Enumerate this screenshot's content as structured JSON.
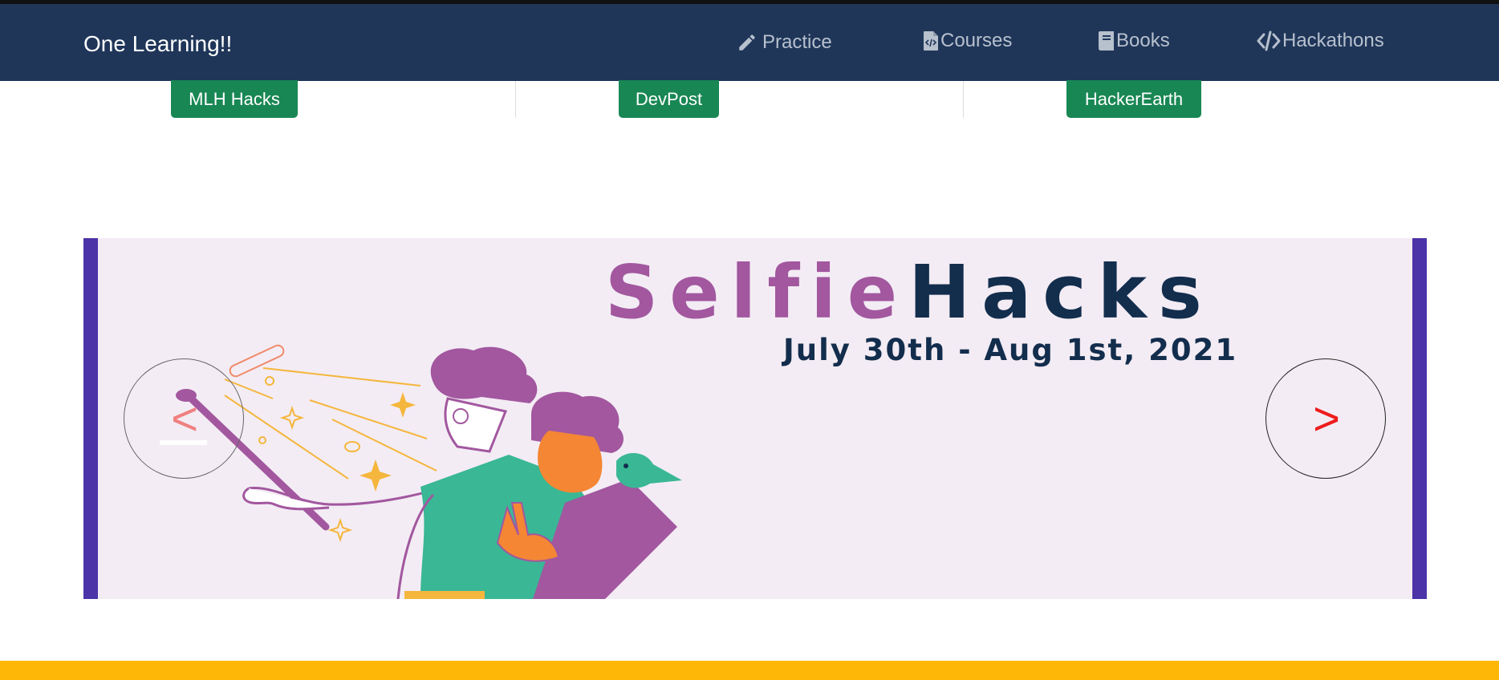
{
  "navbar": {
    "brand": "One Learning!!",
    "items": [
      {
        "label": "Practice",
        "icon": "pencil-icon"
      },
      {
        "label": "Courses",
        "icon": "code-file-icon"
      },
      {
        "label": "Books",
        "icon": "book-icon"
      },
      {
        "label": "Hackathons",
        "icon": "code-icon"
      }
    ]
  },
  "sources": [
    {
      "label": "MLH Hacks"
    },
    {
      "label": "DevPost"
    },
    {
      "label": "HackerEarth"
    }
  ],
  "carousel": {
    "title_part1": "Selfie",
    "title_part2": "Hacks",
    "date": "July 30th - Aug 1st, 2021",
    "prev_label": "<",
    "next_label": ">"
  },
  "colors": {
    "navbar": "#1f3659",
    "button": "#198754",
    "accent_purple": "#a2579f",
    "banner_navy": "#132d4d",
    "carousel_edge": "#4d33a8",
    "footer": "#ffb707"
  }
}
